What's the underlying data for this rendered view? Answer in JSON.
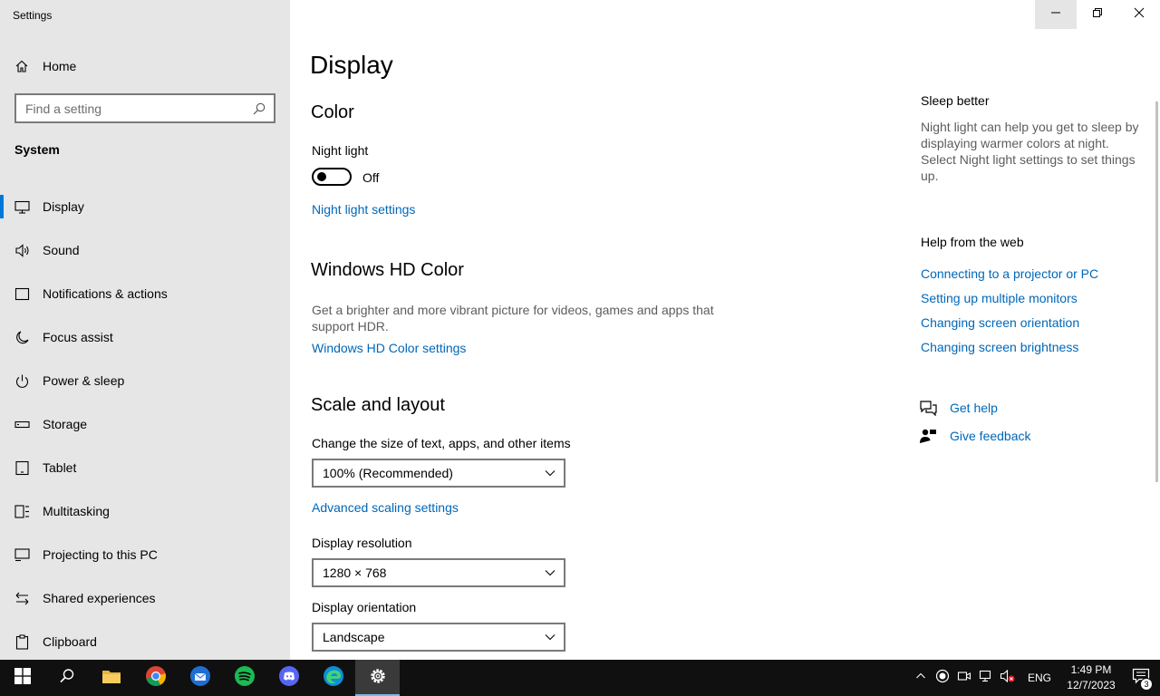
{
  "window": {
    "app_title": "Settings",
    "buttons": {
      "minimize_icon": "minimize-icon",
      "maximize_icon": "restore-icon",
      "close_icon": "close-icon"
    }
  },
  "sidebar": {
    "home_label": "Home",
    "search_placeholder": "Find a setting",
    "section_label": "System",
    "items": [
      {
        "label": "Display",
        "icon": "monitor-icon",
        "active": true
      },
      {
        "label": "Sound",
        "icon": "speaker-icon"
      },
      {
        "label": "Notifications & actions",
        "icon": "notification-icon"
      },
      {
        "label": "Focus assist",
        "icon": "moon-icon"
      },
      {
        "label": "Power & sleep",
        "icon": "power-icon"
      },
      {
        "label": "Storage",
        "icon": "storage-icon"
      },
      {
        "label": "Tablet",
        "icon": "tablet-icon"
      },
      {
        "label": "Multitasking",
        "icon": "multitasking-icon"
      },
      {
        "label": "Projecting to this PC",
        "icon": "projecting-icon"
      },
      {
        "label": "Shared experiences",
        "icon": "shared-experiences-icon"
      },
      {
        "label": "Clipboard",
        "icon": "clipboard-icon"
      }
    ]
  },
  "main": {
    "title": "Display",
    "color": {
      "heading": "Color",
      "night_light_label": "Night light",
      "night_light_state": "Off",
      "night_light_settings_link": "Night light settings"
    },
    "hd_color": {
      "heading": "Windows HD Color",
      "description": "Get a brighter and more vibrant picture for videos, games and apps that support HDR.",
      "settings_link": "Windows HD Color settings"
    },
    "scale_layout": {
      "heading": "Scale and layout",
      "size_label": "Change the size of text, apps, and other items",
      "size_value": "100% (Recommended)",
      "advanced_link": "Advanced scaling settings",
      "resolution_label": "Display resolution",
      "resolution_value": "1280 × 768",
      "orientation_label": "Display orientation",
      "orientation_value": "Landscape"
    }
  },
  "right_panel": {
    "sleep_heading": "Sleep better",
    "sleep_text": "Night light can help you get to sleep by displaying warmer colors at night. Select Night light settings to set things up.",
    "help_heading": "Help from the web",
    "help_links": [
      "Connecting to a projector or PC",
      "Setting up multiple monitors",
      "Changing screen orientation",
      "Changing screen brightness"
    ],
    "get_help": "Get help",
    "give_feedback": "Give feedback"
  },
  "taskbar": {
    "apps": [
      "start-icon",
      "search-icon",
      "file-explorer-icon",
      "chrome-icon",
      "thunderbird-icon",
      "spotify-icon",
      "discord-icon",
      "edge-icon",
      "settings-icon"
    ],
    "language": "ENG",
    "time": "1:49 PM",
    "date": "12/7/2023",
    "notification_count": "3"
  },
  "colors": {
    "accent": "#0078d7",
    "link": "#0067b8",
    "sidebar_bg": "#e6e6e6",
    "taskbar_bg": "#101010"
  }
}
